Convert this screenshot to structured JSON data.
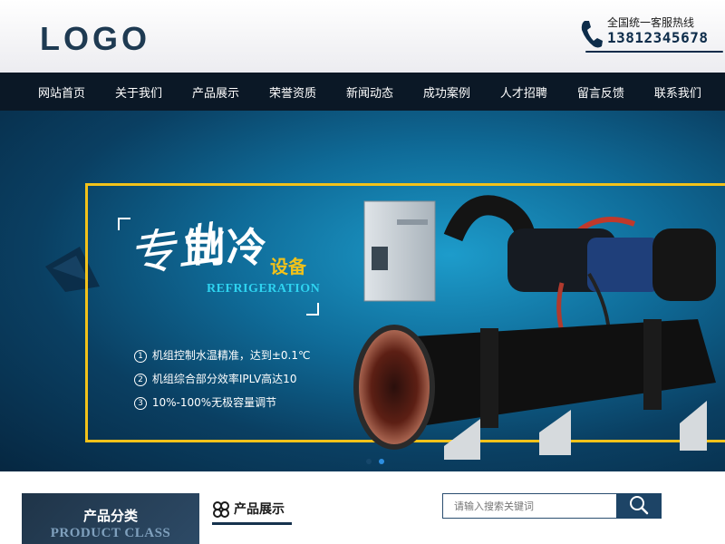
{
  "header": {
    "logo": "LOGO",
    "hotline_label": "全国统一客服热线",
    "hotline_number": "13812345678"
  },
  "nav": {
    "items": [
      "网站首页",
      "关于我们",
      "产品展示",
      "荣誉资质",
      "新闻动态",
      "成功案例",
      "人才招聘",
      "留言反馈",
      "联系我们"
    ]
  },
  "banner": {
    "title_zhuan_ye": "专业",
    "title_main": "制冷",
    "title_sub": "设备",
    "title_en": "REFRIGERATION",
    "features": [
      {
        "num": "1",
        "text": "机组控制水温精准，达到±0.1℃"
      },
      {
        "num": "2",
        "text": "机组综合部分效率IPLV高达10"
      },
      {
        "num": "3",
        "text": "10%-100%无极容量调节"
      }
    ],
    "slides": 2,
    "active_slide": 2
  },
  "bottom": {
    "category_title": "产品分类",
    "category_sub": "PRODUCT CLASS",
    "show_title": "产品展示",
    "search_placeholder": "请输入搜索关键词"
  },
  "colors": {
    "nav_bg": "#0b1826",
    "accent_yellow": "#f2c21a",
    "accent_cyan": "#2ed3f0",
    "dark_blue": "#1d4466"
  }
}
